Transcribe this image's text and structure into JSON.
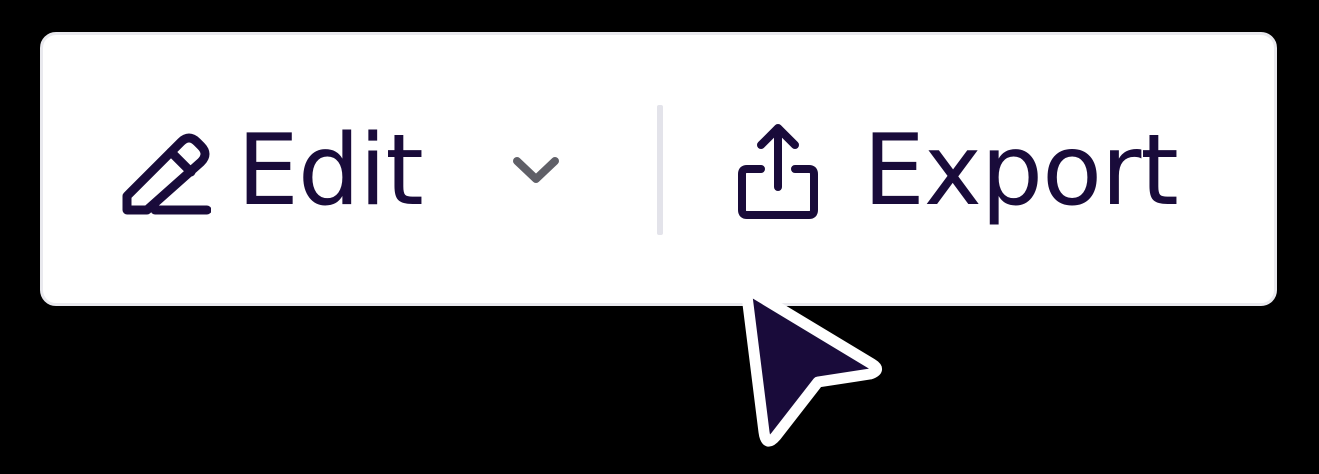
{
  "toolbar": {
    "edit_label": "Edit",
    "export_label": "Export"
  },
  "icons": {
    "edit": "pencil-icon",
    "dropdown": "chevron-down-icon",
    "export": "share-upload-icon",
    "cursor": "mouse-pointer-icon"
  },
  "colors": {
    "text": "#190b3a",
    "chevron": "#5f5f67",
    "divider": "#e3e3ea",
    "panel": "#ffffff",
    "background": "#000000"
  }
}
